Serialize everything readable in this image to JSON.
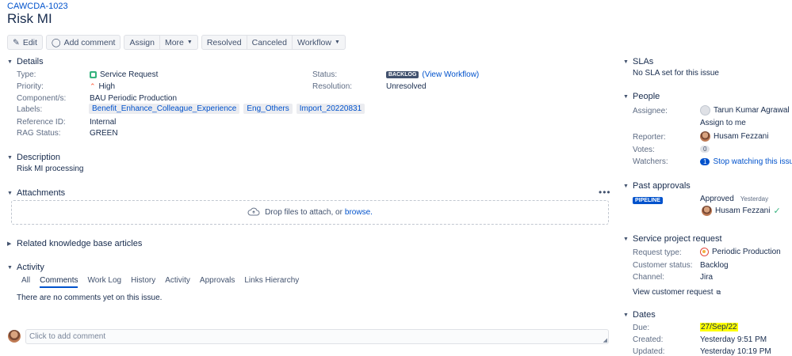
{
  "issue": {
    "key": "CAWCDA-1023",
    "title": "Risk MI"
  },
  "toolbar": {
    "edit": "Edit",
    "add_comment": "Add comment",
    "assign": "Assign",
    "more": "More",
    "resolved": "Resolved",
    "canceled": "Canceled",
    "workflow": "Workflow"
  },
  "details": {
    "heading": "Details",
    "type_label": "Type:",
    "type_value": "Service Request",
    "priority_label": "Priority:",
    "priority_value": "High",
    "component_label": "Component/s:",
    "component_value": "BAU Periodic Production",
    "labels_label": "Labels:",
    "labels": [
      "Benefit_Enhance_Colleague_Experience",
      "Eng_Others",
      "Import_20220831"
    ],
    "refid_label": "Reference ID:",
    "refid_value": "Internal",
    "rag_label": "RAG Status:",
    "rag_value": "GREEN",
    "status_label": "Status:",
    "status_value": "BACKLOG",
    "view_workflow": "(View Workflow)",
    "resolution_label": "Resolution:",
    "resolution_value": "Unresolved"
  },
  "description": {
    "heading": "Description",
    "text": "Risk MI processing"
  },
  "attachments": {
    "heading": "Attachments",
    "menu": "•••",
    "drop_text": "Drop files to attach, or",
    "browse": "browse."
  },
  "kb": {
    "heading": "Related knowledge base articles"
  },
  "activity": {
    "heading": "Activity",
    "tabs": [
      "All",
      "Comments",
      "Work Log",
      "History",
      "Activity",
      "Approvals",
      "Links Hierarchy"
    ],
    "active_tab": "Comments",
    "empty": "There are no comments yet on this issue.",
    "comment_placeholder": "Click to add comment"
  },
  "slas": {
    "heading": "SLAs",
    "text": "No SLA set for this issue"
  },
  "people": {
    "heading": "People",
    "assignee_label": "Assignee:",
    "assignee": "Tarun Kumar Agrawal",
    "assign_to_me": "Assign to me",
    "reporter_label": "Reporter:",
    "reporter": "Husam Fezzani",
    "votes_label": "Votes:",
    "votes": "0",
    "watchers_label": "Watchers:",
    "watchers": "1",
    "stop_watching": "Stop watching this issue"
  },
  "approvals": {
    "heading": "Past approvals",
    "badge": "PIPELINE",
    "status": "Approved",
    "when": "Yesterday",
    "approver": "Husam Fezzani"
  },
  "service": {
    "heading": "Service project request",
    "request_type_label": "Request type:",
    "request_type": "Periodic Production",
    "customer_status_label": "Customer status:",
    "customer_status": "Backlog",
    "channel_label": "Channel:",
    "channel": "Jira",
    "view_customer": "View customer request"
  },
  "dates": {
    "heading": "Dates",
    "due_label": "Due:",
    "due": "27/Sep/22",
    "created_label": "Created:",
    "created": "Yesterday 9:51 PM",
    "updated_label": "Updated:",
    "updated": "Yesterday 10:19 PM"
  }
}
